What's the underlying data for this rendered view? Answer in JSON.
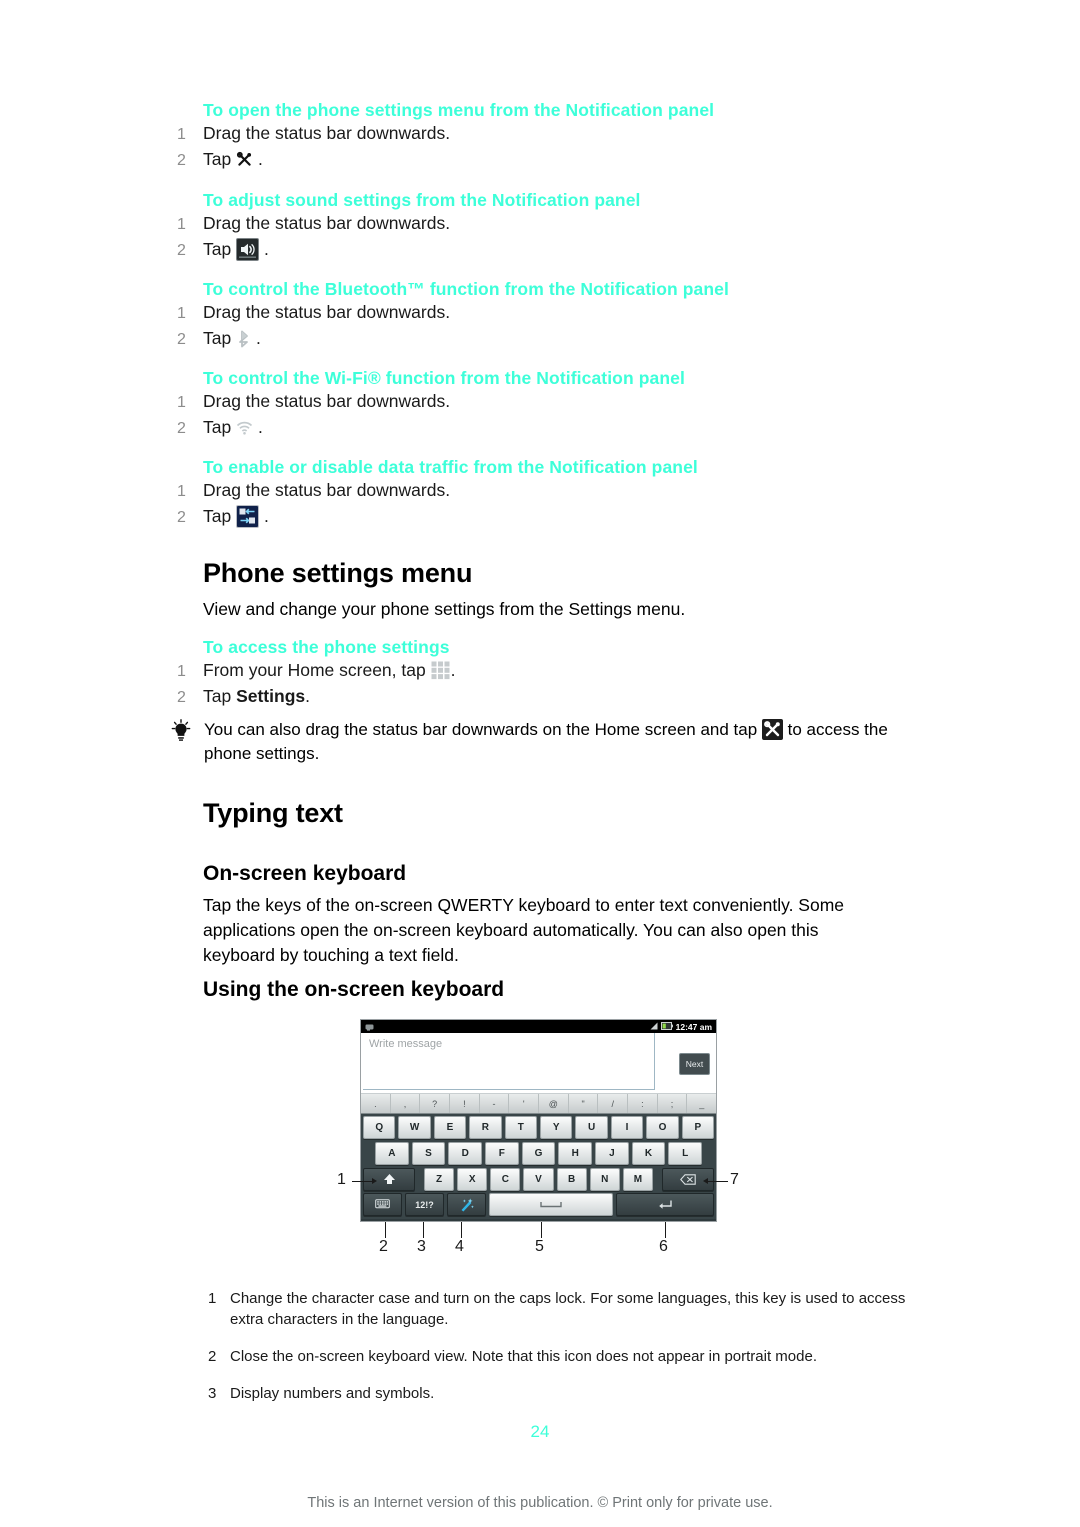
{
  "procedures": [
    {
      "heading": "To open the phone settings menu from the Notification panel",
      "steps": [
        {
          "num": "1",
          "text": "Drag the status bar downwards."
        },
        {
          "num": "2",
          "text": "Tap",
          "icon": "tools-plain-icon",
          "trailing": "."
        }
      ]
    },
    {
      "heading": "To adjust sound settings from the Notification panel",
      "steps": [
        {
          "num": "1",
          "text": "Drag the status bar downwards."
        },
        {
          "num": "2",
          "text": "Tap",
          "icon": "speaker-icon",
          "trailing": "."
        }
      ]
    },
    {
      "heading": "To control the Bluetooth™ function from the Notification panel",
      "steps": [
        {
          "num": "1",
          "text": "Drag the status bar downwards."
        },
        {
          "num": "2",
          "text": "Tap",
          "icon": "bluetooth-icon",
          "trailing": "."
        }
      ]
    },
    {
      "heading": "To control the Wi-Fi® function from the Notification panel",
      "steps": [
        {
          "num": "1",
          "text": "Drag the status bar downwards."
        },
        {
          "num": "2",
          "text": "Tap",
          "icon": "wifi-icon",
          "trailing": "."
        }
      ]
    },
    {
      "heading": "To enable or disable data traffic from the Notification panel",
      "steps": [
        {
          "num": "1",
          "text": "Drag the status bar downwards."
        },
        {
          "num": "2",
          "text": "Tap",
          "icon": "data-traffic-icon",
          "trailing": "."
        }
      ]
    }
  ],
  "phone_settings": {
    "title": "Phone settings menu",
    "intro": "View and change your phone settings from the Settings menu.",
    "procedure_heading": "To access the phone settings",
    "step1_num": "1",
    "step1_text": "From your Home screen, tap",
    "step1_trailing": ".",
    "step2_num": "2",
    "step2_prefix": "Tap ",
    "step2_bold": "Settings",
    "step2_trailing": ".",
    "tip_prefix": "You can also drag the status bar downwards on the Home screen and tap",
    "tip_suffix": "to access the",
    "tip_line2": "phone settings."
  },
  "typing_text": {
    "title": "Typing text",
    "subtitle_onscreen": "On-screen keyboard",
    "paragraph": "Tap the keys of the on-screen QWERTY keyboard to enter text conveniently. Some applications open the on-screen keyboard automatically. You can also open this keyboard by touching a text field.",
    "subtitle_using": "Using the on-screen keyboard"
  },
  "screenshot": {
    "status_time": "12:47 am",
    "message_placeholder": "Write message",
    "next_button": "Next",
    "symbol_row": [
      ".",
      ",",
      "?",
      "!",
      "-",
      "'",
      "@",
      "\"",
      "/",
      ":",
      ";",
      "_"
    ],
    "row_q": [
      "Q",
      "W",
      "E",
      "R",
      "T",
      "Y",
      "U",
      "I",
      "O",
      "P"
    ],
    "row_a": [
      "A",
      "S",
      "D",
      "F",
      "G",
      "H",
      "J",
      "K",
      "L"
    ],
    "row_z": [
      "Z",
      "X",
      "C",
      "V",
      "B",
      "N",
      "M"
    ],
    "shift_key": "shift-up-arrow-icon",
    "delete_key": "backspace-icon",
    "hide_keyboard_key": "hide-keyboard-icon",
    "numbers_key": "12!?",
    "smiley_key": "magic-wand-icon",
    "space_key": "space-bar-icon",
    "enter_key": "enter-arrow-icon",
    "callouts": [
      "1",
      "2",
      "3",
      "4",
      "5",
      "6",
      "7"
    ]
  },
  "captions": [
    {
      "num": "1",
      "text": "Change the character case and turn on the caps lock. For some languages, this key is used to access extra characters in the language."
    },
    {
      "num": "2",
      "text": "Close the on-screen keyboard view. Note that this icon does not appear in portrait mode."
    },
    {
      "num": "3",
      "text": "Display numbers and symbols."
    }
  ],
  "page_number": "24",
  "footer": "This is an Internet version of this publication. © Print only for private use.",
  "colors": {
    "accent": "#3dffd9",
    "text": "#1a1a1a",
    "muted": "#8c8c8c",
    "footer": "#6f7577"
  }
}
